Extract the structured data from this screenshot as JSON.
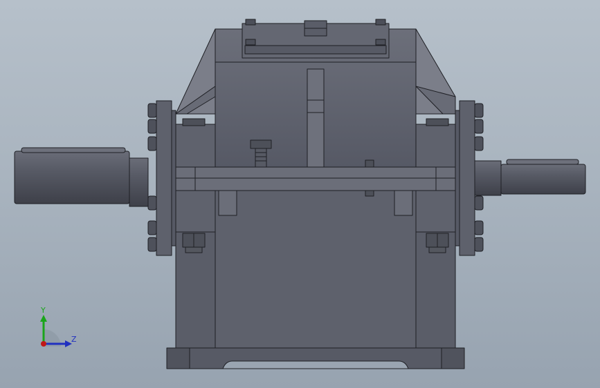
{
  "viewport": {
    "background_top": "#b6c0ca",
    "background_bottom": "#97a3b0"
  },
  "model": {
    "name": "gear-reducer-housing",
    "body_color": "#5c5f69",
    "shaft_color": "#4a4d57",
    "edge_color": "#1e1f24"
  },
  "triad": {
    "y_label": "Y",
    "z_label": "Z",
    "y_color": "#1aa51a",
    "z_color": "#2030c0",
    "x_dot_color": "#c01818"
  }
}
